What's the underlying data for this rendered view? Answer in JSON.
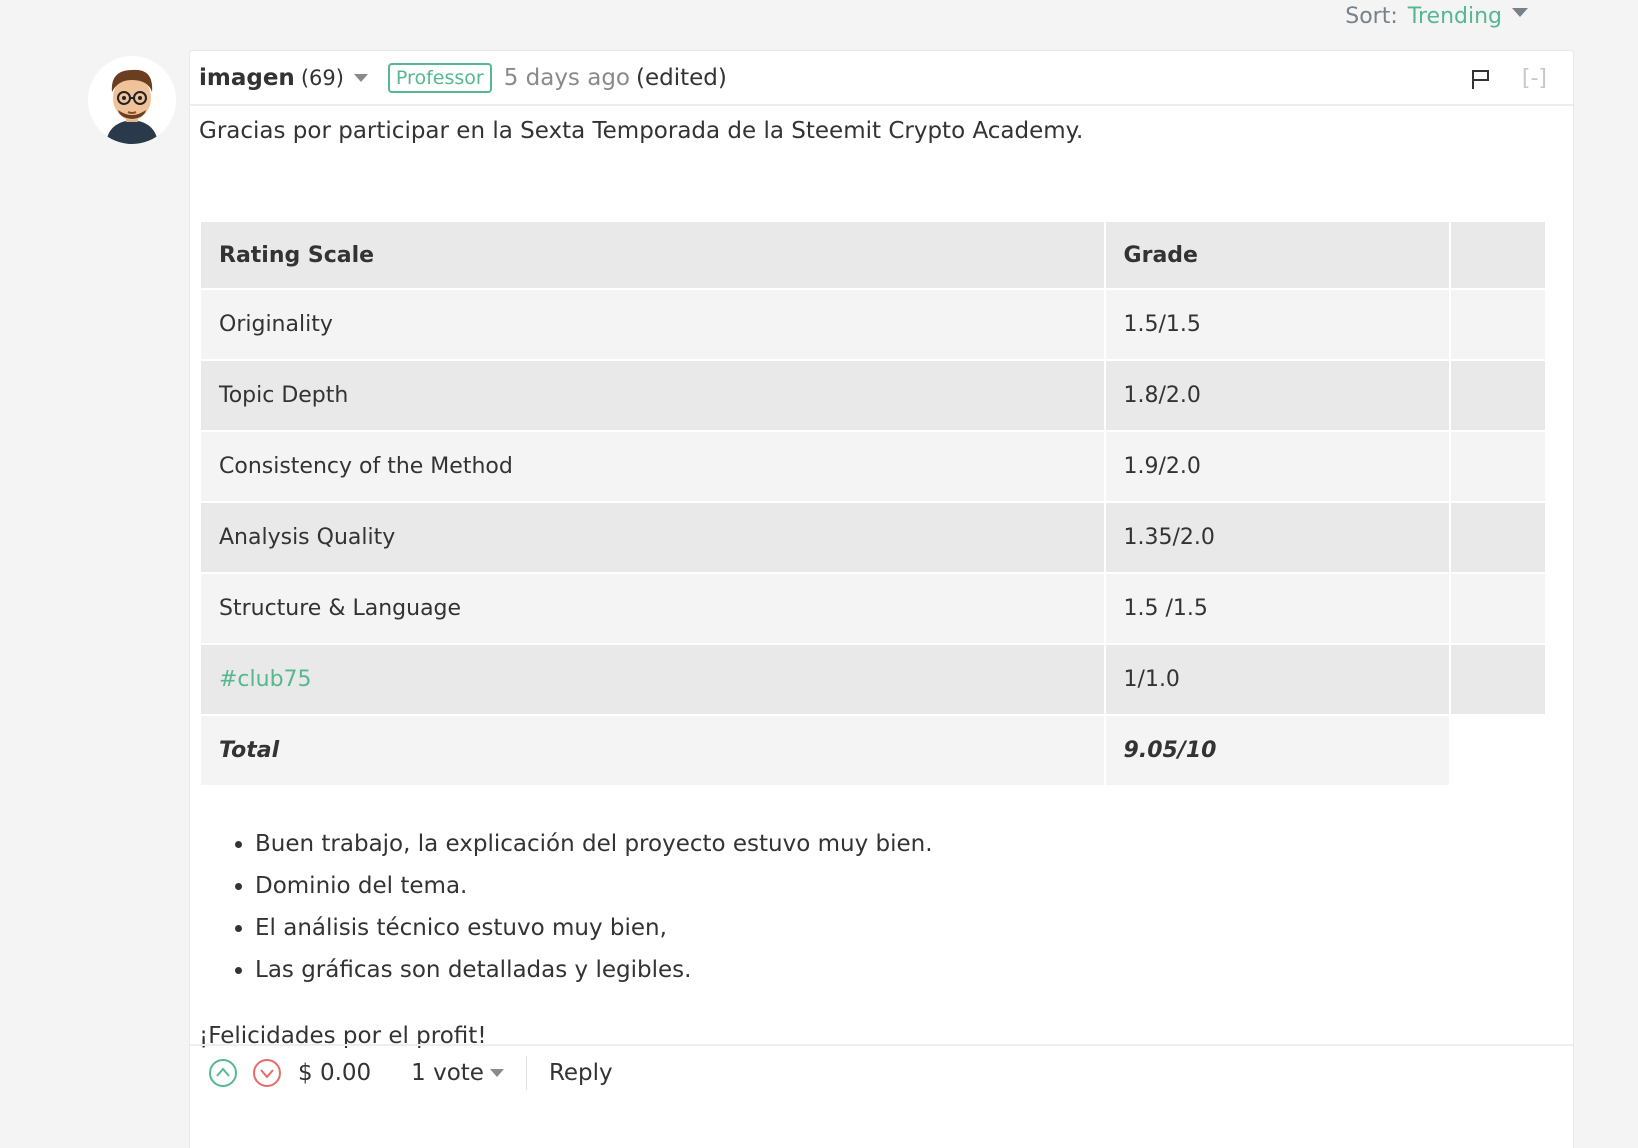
{
  "sort": {
    "label": "Sort:",
    "value": "Trending"
  },
  "comment": {
    "author": "imagen",
    "reputation": "(69)",
    "badge": "Professor",
    "timestamp": "5 days ago",
    "edited": "(edited)",
    "collapse": "[-]",
    "intro": "Gracias por participar en la Sexta Temporada de la Steemit Crypto Academy.",
    "table": {
      "headers": [
        "Rating Scale",
        "Grade"
      ],
      "rows": [
        {
          "criterion": "Originality",
          "grade": "1.5/1.5"
        },
        {
          "criterion": "Topic Depth",
          "grade": "1.8/2.0"
        },
        {
          "criterion": "Consistency of the Method",
          "grade": "1.9/2.0"
        },
        {
          "criterion": "Analysis Quality",
          "grade": "1.35/2.0"
        },
        {
          "criterion": "Structure & Language",
          "grade": "1.5 /1.5"
        },
        {
          "criterion": "#club75",
          "grade": "1/1.0"
        }
      ],
      "total": {
        "label": "Total",
        "grade": "9.05/10"
      }
    },
    "notes": [
      "Buen trabajo, la explicación del proyecto estuvo muy bien.",
      "Dominio del tema.",
      "El análisis técnico estuvo muy bien,",
      "Las gráficas son detalladas y legibles."
    ],
    "closing": "¡Felicidades por el profit!",
    "footer": {
      "payout": "$ 0.00",
      "votes": "1 vote",
      "reply": "Reply"
    }
  },
  "colors": {
    "accent": "#56b890",
    "downvote": "#e86b6b"
  }
}
